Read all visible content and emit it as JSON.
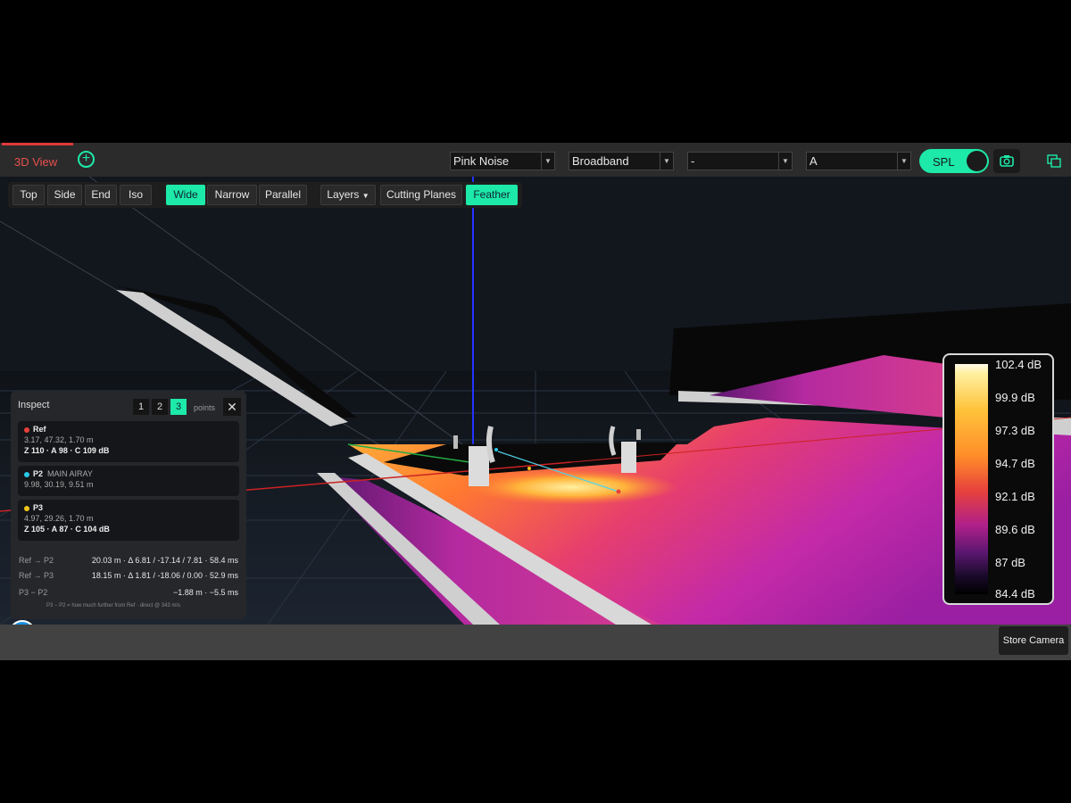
{
  "tab": {
    "label": "3D View"
  },
  "selects": {
    "signal": {
      "value": "Pink Noise"
    },
    "band": {
      "value": "Broadband"
    },
    "frequency": {
      "value": "-"
    },
    "weighting": {
      "value": "A"
    }
  },
  "spl_toggle": {
    "label": "SPL",
    "on": true
  },
  "toolbar": {
    "views": [
      "Top",
      "Side",
      "End",
      "Iso"
    ],
    "widths": [
      "Wide",
      "Narrow",
      "Parallel"
    ],
    "active_width": "Wide",
    "layers": "Layers",
    "cutting_planes": "Cutting Planes",
    "feather": "Feather",
    "feather_active": true
  },
  "inspect": {
    "title": "Inspect",
    "point_buttons": [
      "1",
      "2",
      "3"
    ],
    "active_points": "3",
    "points_label": "points",
    "close": "✕",
    "cards": [
      {
        "color": "#e8413c",
        "name": "Ref",
        "sub": "",
        "line2": "3.17, 47.32, 1.70 m",
        "line3": "Z 110 · A 98 · C 109 dB"
      },
      {
        "color": "#29c9e8",
        "name": "P2",
        "sub": "MAIN AIRAY",
        "line2": "9.98, 30.19, 9.51 m",
        "line3": ""
      },
      {
        "color": "#f0c419",
        "name": "P3",
        "sub": "",
        "line2": "4.97, 29.26, 1.70 m",
        "line3": "Z 105 · A 87 · C 104 dB"
      }
    ],
    "rows": [
      {
        "label": "Ref → P2",
        "value": "20.03 m · Δ 6.81 / -17.14 / 7.81 · 58.4 ms"
      },
      {
        "label": "Ref → P3",
        "value": "18.15 m · Δ 1.81 / -18.06 / 0.00 · 52.9 ms"
      },
      {
        "label": "P3 − P2",
        "value": "−1.88 m · −5.5 ms"
      }
    ],
    "footnote": "P3 − P2 = how much further from Ref · direct @ 343 m/s"
  },
  "legend": {
    "labels": [
      "102.4 dB",
      "99.9 dB",
      "97.3 dB",
      "94.7 dB",
      "92.1 dB",
      "89.6 dB",
      "87 dB",
      "84.4 dB"
    ]
  },
  "info_button": "i",
  "store_camera": "Store Camera",
  "icons": {
    "add": "plus-circle-icon",
    "camera": "camera-icon",
    "copy": "copy-windows-icon",
    "info": "info-icon",
    "close": "close-icon"
  },
  "colors": {
    "accent": "#1de9a8",
    "tab_active": "#e8504e",
    "info": "#1a8fe0"
  }
}
